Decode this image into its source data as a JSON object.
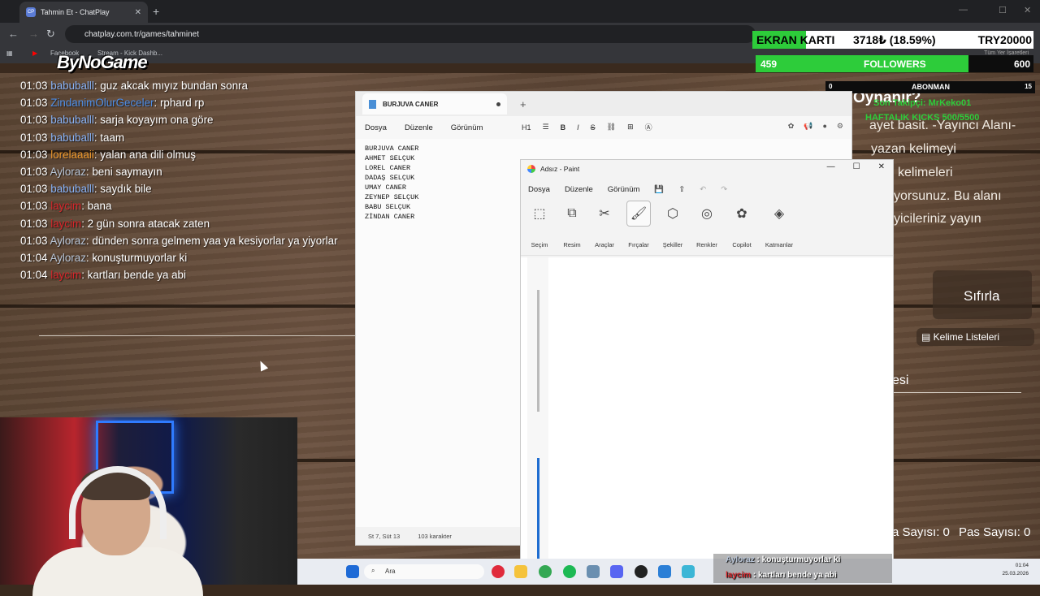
{
  "browser": {
    "tab_title": "Tahmin Et - ChatPlay",
    "tab_favicon": "CP",
    "url": "chatplay.com.tr/games/tahminet",
    "bookmarks": [
      "Facebook",
      "Stream - Kick Dashb..."
    ],
    "all_bookmarks": "Tüm Yer İşaretleri"
  },
  "logo": "ByNoGame",
  "chat": [
    {
      "time": "01:03",
      "user": "babuballl",
      "color": "#8ab4f8",
      "text": ": guz akcak mıyız bundan sonra"
    },
    {
      "time": "01:03",
      "user": "ZindanimOlurGeceler",
      "color": "#4f8fe8",
      "text": ": rphard rp"
    },
    {
      "time": "01:03",
      "user": "babuballl",
      "color": "#8ab4f8",
      "text": ": sarja koyayım ona göre"
    },
    {
      "time": "01:03",
      "user": "babuballl",
      "color": "#8ab4f8",
      "text": ": taam"
    },
    {
      "time": "01:03",
      "user": "lorelaaaii",
      "color": "#f19a2c",
      "text": ": yalan ana dili olmuş"
    },
    {
      "time": "01:03",
      "user": "Ayloraz",
      "color": "#b9c6d8",
      "text": ": beni saymayın"
    },
    {
      "time": "01:03",
      "user": "babuballl",
      "color": "#8ab4f8",
      "text": ": saydık bile"
    },
    {
      "time": "01:03",
      "user": "laycim",
      "color": "#d8262b",
      "text": ": bana"
    },
    {
      "time": "01:03",
      "user": "laycim",
      "color": "#d8262b",
      "text": ": 2 gün sonra atacak zaten"
    },
    {
      "time": "01:03",
      "user": "Ayloraz",
      "color": "#b9c6d8",
      "text": ": dünden sonra gelmem yaa ya kesiyorlar ya yiyorlar"
    },
    {
      "time": "01:04",
      "user": "Ayloraz",
      "color": "#b9c6d8",
      "text": ": konuşturmuyorlar ki"
    },
    {
      "time": "01:04",
      "user": "laycim",
      "color": "#d8262b",
      "text": ": kartları bende ya abi"
    }
  ],
  "stats": {
    "ekran_label": "EKRAN KARTI",
    "price": "3718₺ (18.59%)",
    "target": "TRY20000",
    "followers_current": "459",
    "followers_label": "FOLLOWERS",
    "followers_goal": "600",
    "followers_progress": 0.765,
    "abone_current": "0",
    "abone_label": "ABONMAN",
    "abone_goal": "15",
    "son_takipci": "Son Takipçi: MrKeko01",
    "haftalik": "HAFTALIK KICKS 500/5500"
  },
  "game": {
    "title_fragment": "Oynanır?",
    "lines": [
      "ayet basit. -Yayıncı Alanı-",
      "yazan kelimeyi",
      "kelimeleri",
      "yorsunuz. Bu alanı",
      "yicileriniz yayın"
    ],
    "reset": "Sıfırla",
    "word_lists": "Kelime Listeleri",
    "section": "esi",
    "score_a": "a Sayısı: 0",
    "score_b": "Pas Sayısı: 0"
  },
  "notepad": {
    "tab_title": "BURJUVA CANER",
    "menu": [
      "Dosya",
      "Düzenle",
      "Görünüm"
    ],
    "heading_tool": "H1",
    "lines": [
      "BURJUVA CANER",
      "AHMET SELÇUK",
      "LOREL CANER",
      "DADAŞ SELÇUK",
      "UMAY CANER",
      "ZEYNEP SELÇUK",
      "BABU SELÇUK",
      "ZİNDAN CANER"
    ],
    "status_pos": "St 7, Süt 13",
    "status_chars": "103 karakter"
  },
  "paint": {
    "title": "Adsız - Paint",
    "menu": [
      "Dosya",
      "Düzenle",
      "Görünüm"
    ],
    "tools": [
      {
        "label": "Seçim",
        "icon": "selection-icon",
        "glyph": "⬚"
      },
      {
        "label": "Resim",
        "icon": "image-icon",
        "glyph": "⧉"
      },
      {
        "label": "Araçlar",
        "icon": "tools-icon",
        "glyph": "✂"
      },
      {
        "label": "Fırçalar",
        "icon": "brush-icon",
        "glyph": "🖌"
      },
      {
        "label": "Şekiller",
        "icon": "shapes-icon",
        "glyph": "⬡"
      },
      {
        "label": "Renkler",
        "icon": "palette-icon",
        "glyph": "◎"
      },
      {
        "label": "Copilot",
        "icon": "copilot-icon",
        "glyph": "✿"
      },
      {
        "label": "Katmanlar",
        "icon": "layers-icon",
        "glyph": "◈"
      }
    ]
  },
  "taskbar": {
    "search_placeholder": "Ara",
    "time": "01:04",
    "date": "25.03.2026"
  },
  "notifications": [
    {
      "user": "Ayloraz",
      "text": " : konuşturmuyorlar ki",
      "color": "#b9c6d8"
    },
    {
      "user": "laycim",
      "text": " : kartları bende ya abi",
      "color": "#d8262b"
    }
  ],
  "colors": {
    "green": "#2dcc3a",
    "wood": "#5f4838",
    "accent_blue": "#1f6dd0"
  }
}
